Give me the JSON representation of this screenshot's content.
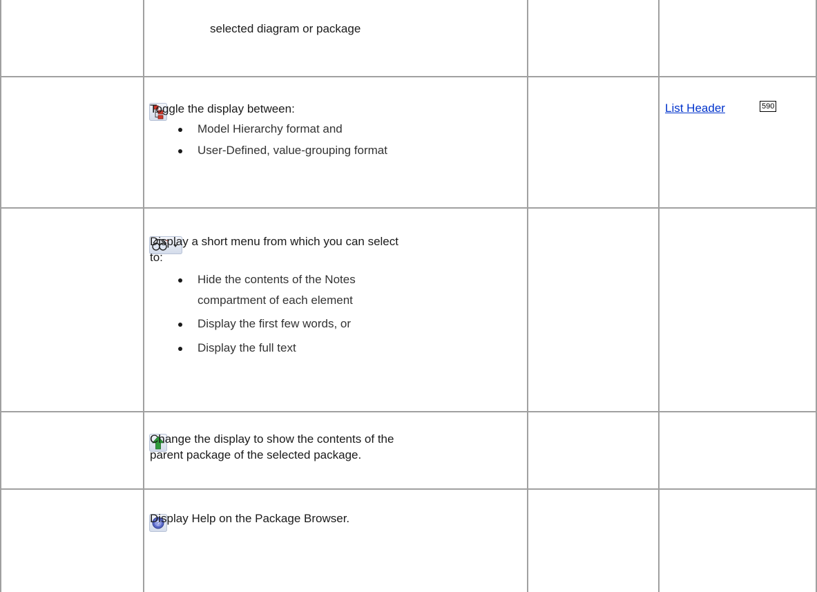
{
  "rows": [
    {
      "description": "selected diagram or package"
    },
    {
      "icon": "hierarchy-toggle-icon",
      "description": "Toggle the display between:",
      "bullets": [
        "Model Hierarchy format and",
        "User-Defined, value-grouping format"
      ],
      "see_also": {
        "link": "List Header",
        "page": "590"
      }
    },
    {
      "icon": "notes-display-dropdown-icon",
      "description_lines": [
        "Display a short menu from which you can select",
        "to:"
      ],
      "bullets": [
        "Hide the contents of the Notes",
        "compartment of each element",
        "Display the first few words, or",
        "Display the full text"
      ]
    },
    {
      "icon": "green-up-arrow-icon",
      "description_lines": [
        "Change the display to show the contents of the",
        "parent package of the selected package."
      ]
    },
    {
      "icon": "help-icon",
      "description": "Display Help on the Package Browser."
    }
  ],
  "colors": {
    "grid": "#a0a0a0",
    "link": "#0033cc",
    "arrow": "#2e9b3a",
    "help": "#5a69c8"
  }
}
